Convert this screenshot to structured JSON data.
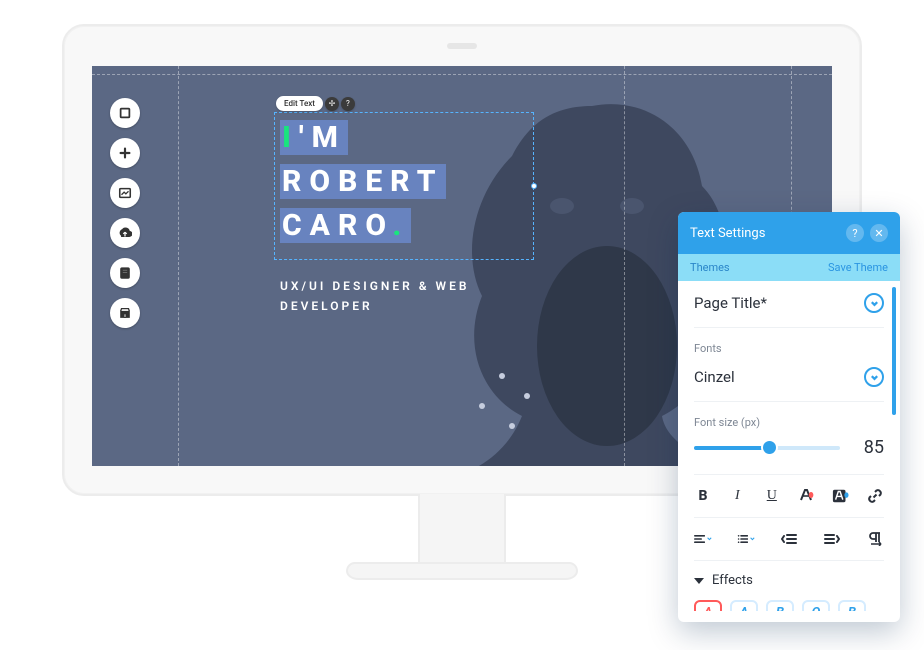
{
  "app": {
    "edit_text_label": "Edit Text"
  },
  "hero": {
    "line1_word1": "I",
    "line1_word2": "'",
    "line1_word3": "M",
    "line2": "ROBERT",
    "line3": "CARO",
    "period": ".",
    "subtitle_line1": "UX/UI DESIGNER & WEB",
    "subtitle_line2": "DEVELOPER"
  },
  "panel": {
    "title": "Text Settings",
    "help": "?",
    "close": "✕",
    "themes_label": "Themes",
    "save_theme": "Save Theme",
    "theme_value": "Page Title*",
    "fonts_label": "Fonts",
    "font_value": "Cinzel",
    "font_size_label": "Font size (px)",
    "font_size_value": "85",
    "effects_label": "Effects",
    "chips": {
      "a": "A",
      "b": "A",
      "c": "B",
      "d": "Q",
      "e": "B"
    }
  },
  "format": {
    "bold": "B",
    "italic": "I",
    "underline": "U"
  }
}
